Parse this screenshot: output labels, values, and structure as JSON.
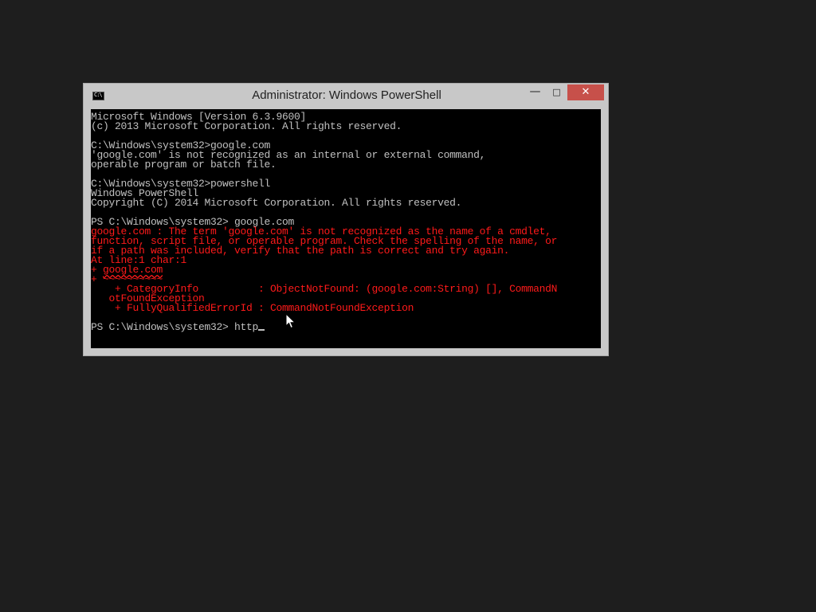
{
  "window": {
    "title": "Administrator: Windows PowerShell",
    "icon_glyph": "C:\\",
    "controls": {
      "minimize": "—",
      "maximize": "□",
      "close": "✕"
    }
  },
  "console": {
    "text_color": "#c0c0c0",
    "error_color": "#ff1a1a",
    "background": "#000000",
    "lines": {
      "l01": "Microsoft Windows [Version 6.3.9600]",
      "l02": "(c) 2013 Microsoft Corporation. All rights reserved.",
      "l03": "",
      "l04": "C:\\Windows\\system32>google.com",
      "l05": "'google.com' is not recognized as an internal or external command,",
      "l06": "operable program or batch file.",
      "l07": "",
      "l08": "C:\\Windows\\system32>powershell",
      "l09": "Windows PowerShell",
      "l10": "Copyright (C) 2014 Microsoft Corporation. All rights reserved.",
      "l11": "",
      "l12": "PS C:\\Windows\\system32> google.com",
      "e13": "google.com : The term 'google.com' is not recognized as the name of a cmdlet,",
      "e14": "function, script file, or operable program. Check the spelling of the name, or",
      "e15": "if a path was included, verify that the path is correct and try again.",
      "e16": "At line:1 char:1",
      "e17_prefix": "+ ",
      "e17_cmd": "google.com",
      "e18": "+ ~~~~~~~~~~",
      "e19": "    + CategoryInfo          : ObjectNotFound: (google.com:String) [], CommandN",
      "e20": "   otFoundException",
      "e21": "    + FullyQualifiedErrorId : CommandNotFoundException",
      "l22": "",
      "l23_prompt": "PS C:\\Windows\\system32> ",
      "l23_input": "http"
    }
  },
  "pointer": {
    "icon": "mouse-arrow-icon"
  }
}
